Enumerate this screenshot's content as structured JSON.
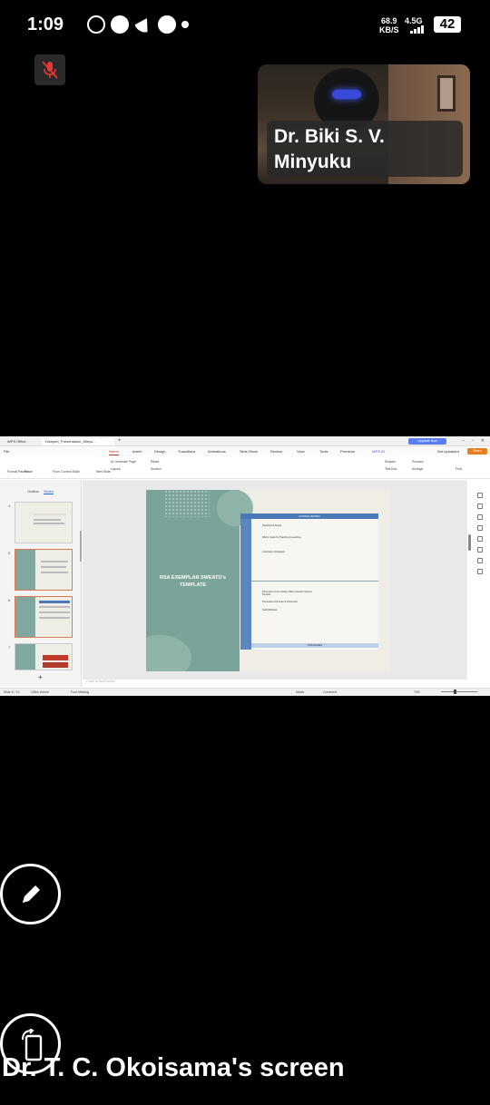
{
  "status_bar": {
    "time": "1:09",
    "net_speed": "68.9",
    "net_unit": "KB/S",
    "network": "4.5G",
    "battery": "42"
  },
  "meeting": {
    "participant_name": "Dr. Biki S. V. Minyuku",
    "screen_label": "Dr. T. C. Okoisama's screen"
  },
  "shared_app": {
    "tabs": [
      "WPS Office",
      "Dissport_Presentation_Minyu..."
    ],
    "upgrade_label": "Upgrade Now",
    "menu": [
      "File",
      "Home",
      "Insert",
      "Design",
      "Transitions",
      "Animations",
      "Slide Show",
      "Review",
      "View",
      "Tools",
      "Premium",
      "WPS AI"
    ],
    "active_menu": "Home",
    "not_uploaded": "Not uploaded",
    "share_label": "Share",
    "ribbon": {
      "format_painter": "Format Painter",
      "paste": "Paste",
      "from_current_slide": "From Current Slide",
      "new_slide": "New Slide",
      "ai_generate_page": "AI Generate Page",
      "reset": "Reset",
      "layout": "Layout",
      "section": "Section",
      "shapes": "Shapes",
      "pictures": "Pictures",
      "text_box": "Text Box",
      "arrange": "Arrange",
      "find": "Find"
    },
    "panel_tabs": [
      "Outline",
      "Slides"
    ],
    "active_panel_tab": "Slides",
    "slide_numbers": [
      "4",
      "5",
      "6",
      "7"
    ],
    "slide_title": "RSA EXEMPLAR SWEATO's TEMPLATE",
    "table_header": "CONSOLIDATED",
    "table_rows_top": [
      "Institutional Scope",
      "RSA's Goals for Teaching & Learning",
      "Curriculum Strategies"
    ],
    "table_rows_bottom": [
      "Promotion of the Literary Self in Human Interest Pursuits",
      "Promotion of Human & Personnel",
      "Staff Wellness"
    ],
    "table_footer": "STRATEGIES",
    "notes_placeholder": "Click to add notes",
    "status": {
      "slide_indicator": "Slide 6 / 10",
      "theme": "Office theme",
      "font_missing": "Font Missing",
      "notes": "Notes",
      "comment": "Comment",
      "zoom": "76%"
    }
  }
}
